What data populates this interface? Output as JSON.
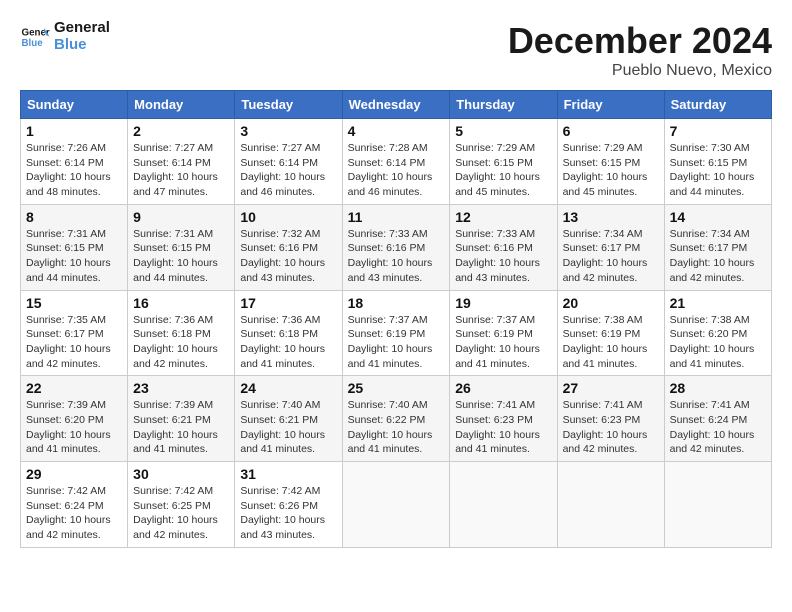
{
  "header": {
    "logo_line1": "General",
    "logo_line2": "Blue",
    "month_title": "December 2024",
    "location": "Pueblo Nuevo, Mexico"
  },
  "days_of_week": [
    "Sunday",
    "Monday",
    "Tuesday",
    "Wednesday",
    "Thursday",
    "Friday",
    "Saturday"
  ],
  "weeks": [
    [
      {
        "day": "1",
        "info": "Sunrise: 7:26 AM\nSunset: 6:14 PM\nDaylight: 10 hours\nand 48 minutes."
      },
      {
        "day": "2",
        "info": "Sunrise: 7:27 AM\nSunset: 6:14 PM\nDaylight: 10 hours\nand 47 minutes."
      },
      {
        "day": "3",
        "info": "Sunrise: 7:27 AM\nSunset: 6:14 PM\nDaylight: 10 hours\nand 46 minutes."
      },
      {
        "day": "4",
        "info": "Sunrise: 7:28 AM\nSunset: 6:14 PM\nDaylight: 10 hours\nand 46 minutes."
      },
      {
        "day": "5",
        "info": "Sunrise: 7:29 AM\nSunset: 6:15 PM\nDaylight: 10 hours\nand 45 minutes."
      },
      {
        "day": "6",
        "info": "Sunrise: 7:29 AM\nSunset: 6:15 PM\nDaylight: 10 hours\nand 45 minutes."
      },
      {
        "day": "7",
        "info": "Sunrise: 7:30 AM\nSunset: 6:15 PM\nDaylight: 10 hours\nand 44 minutes."
      }
    ],
    [
      {
        "day": "8",
        "info": "Sunrise: 7:31 AM\nSunset: 6:15 PM\nDaylight: 10 hours\nand 44 minutes."
      },
      {
        "day": "9",
        "info": "Sunrise: 7:31 AM\nSunset: 6:15 PM\nDaylight: 10 hours\nand 44 minutes."
      },
      {
        "day": "10",
        "info": "Sunrise: 7:32 AM\nSunset: 6:16 PM\nDaylight: 10 hours\nand 43 minutes."
      },
      {
        "day": "11",
        "info": "Sunrise: 7:33 AM\nSunset: 6:16 PM\nDaylight: 10 hours\nand 43 minutes."
      },
      {
        "day": "12",
        "info": "Sunrise: 7:33 AM\nSunset: 6:16 PM\nDaylight: 10 hours\nand 43 minutes."
      },
      {
        "day": "13",
        "info": "Sunrise: 7:34 AM\nSunset: 6:17 PM\nDaylight: 10 hours\nand 42 minutes."
      },
      {
        "day": "14",
        "info": "Sunrise: 7:34 AM\nSunset: 6:17 PM\nDaylight: 10 hours\nand 42 minutes."
      }
    ],
    [
      {
        "day": "15",
        "info": "Sunrise: 7:35 AM\nSunset: 6:17 PM\nDaylight: 10 hours\nand 42 minutes."
      },
      {
        "day": "16",
        "info": "Sunrise: 7:36 AM\nSunset: 6:18 PM\nDaylight: 10 hours\nand 42 minutes."
      },
      {
        "day": "17",
        "info": "Sunrise: 7:36 AM\nSunset: 6:18 PM\nDaylight: 10 hours\nand 41 minutes."
      },
      {
        "day": "18",
        "info": "Sunrise: 7:37 AM\nSunset: 6:19 PM\nDaylight: 10 hours\nand 41 minutes."
      },
      {
        "day": "19",
        "info": "Sunrise: 7:37 AM\nSunset: 6:19 PM\nDaylight: 10 hours\nand 41 minutes."
      },
      {
        "day": "20",
        "info": "Sunrise: 7:38 AM\nSunset: 6:19 PM\nDaylight: 10 hours\nand 41 minutes."
      },
      {
        "day": "21",
        "info": "Sunrise: 7:38 AM\nSunset: 6:20 PM\nDaylight: 10 hours\nand 41 minutes."
      }
    ],
    [
      {
        "day": "22",
        "info": "Sunrise: 7:39 AM\nSunset: 6:20 PM\nDaylight: 10 hours\nand 41 minutes."
      },
      {
        "day": "23",
        "info": "Sunrise: 7:39 AM\nSunset: 6:21 PM\nDaylight: 10 hours\nand 41 minutes."
      },
      {
        "day": "24",
        "info": "Sunrise: 7:40 AM\nSunset: 6:21 PM\nDaylight: 10 hours\nand 41 minutes."
      },
      {
        "day": "25",
        "info": "Sunrise: 7:40 AM\nSunset: 6:22 PM\nDaylight: 10 hours\nand 41 minutes."
      },
      {
        "day": "26",
        "info": "Sunrise: 7:41 AM\nSunset: 6:23 PM\nDaylight: 10 hours\nand 41 minutes."
      },
      {
        "day": "27",
        "info": "Sunrise: 7:41 AM\nSunset: 6:23 PM\nDaylight: 10 hours\nand 42 minutes."
      },
      {
        "day": "28",
        "info": "Sunrise: 7:41 AM\nSunset: 6:24 PM\nDaylight: 10 hours\nand 42 minutes."
      }
    ],
    [
      {
        "day": "29",
        "info": "Sunrise: 7:42 AM\nSunset: 6:24 PM\nDaylight: 10 hours\nand 42 minutes."
      },
      {
        "day": "30",
        "info": "Sunrise: 7:42 AM\nSunset: 6:25 PM\nDaylight: 10 hours\nand 42 minutes."
      },
      {
        "day": "31",
        "info": "Sunrise: 7:42 AM\nSunset: 6:26 PM\nDaylight: 10 hours\nand 43 minutes."
      },
      {
        "day": "",
        "info": ""
      },
      {
        "day": "",
        "info": ""
      },
      {
        "day": "",
        "info": ""
      },
      {
        "day": "",
        "info": ""
      }
    ]
  ]
}
